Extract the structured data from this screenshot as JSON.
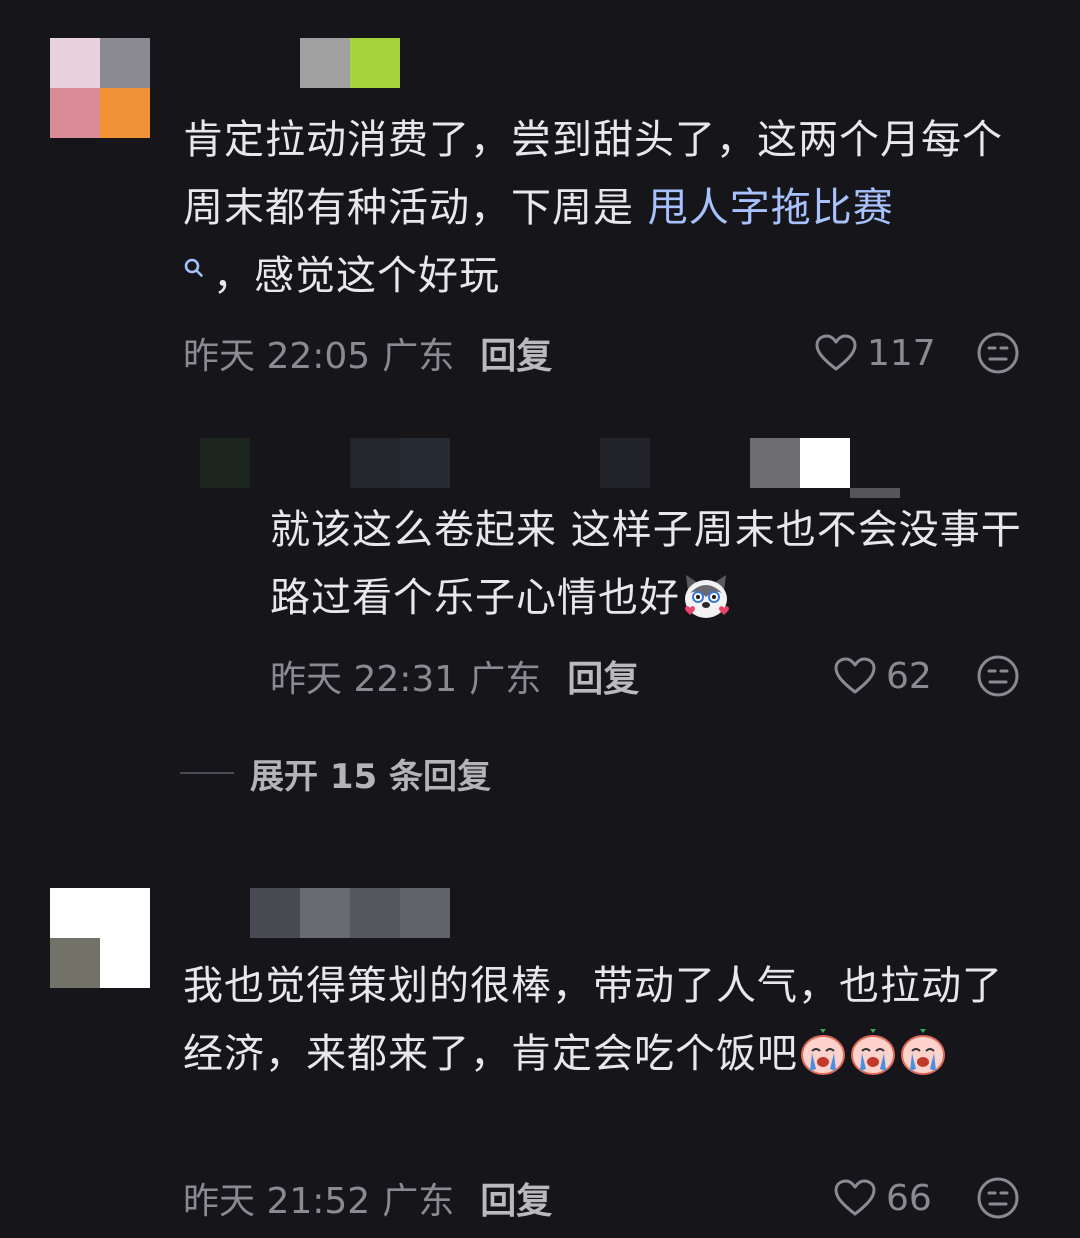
{
  "comments": [
    {
      "text_before": "肯定拉动消费了，尝到甜头了，这两个月每个周末都有种活动，下周是 ",
      "link_text": "甩人字拖比赛",
      "text_after": "，感觉这个好玩",
      "time": "昨天 22:05",
      "location": "广东",
      "reply_label": "回复",
      "likes": "117"
    },
    {
      "text": "就该这么卷起来 这样子周末也不会没事干 路过看个乐子心情也好",
      "time": "昨天 22:31",
      "location": "广东",
      "reply_label": "回复",
      "likes": "62"
    },
    {
      "text": "我也觉得策划的很棒，带动了人气，也拉动了经济，来都来了，肯定会吃个饭吧",
      "time": "昨天 21:52",
      "location": "广东",
      "reply_label": "回复",
      "likes": "66"
    }
  ],
  "expand_replies": "展开 15 条回复",
  "icons": {
    "like": "heart-outline-icon",
    "dislike": "neutral-face-icon",
    "search": "search-icon",
    "emoji_husky": "husky-heart-eyes-emoji",
    "emoji_crying": "crying-peach-emoji"
  },
  "colors": {
    "background": "#16161a",
    "text": "#e8e8ea",
    "meta": "#8a8a90",
    "link": "#a8c2ff"
  }
}
